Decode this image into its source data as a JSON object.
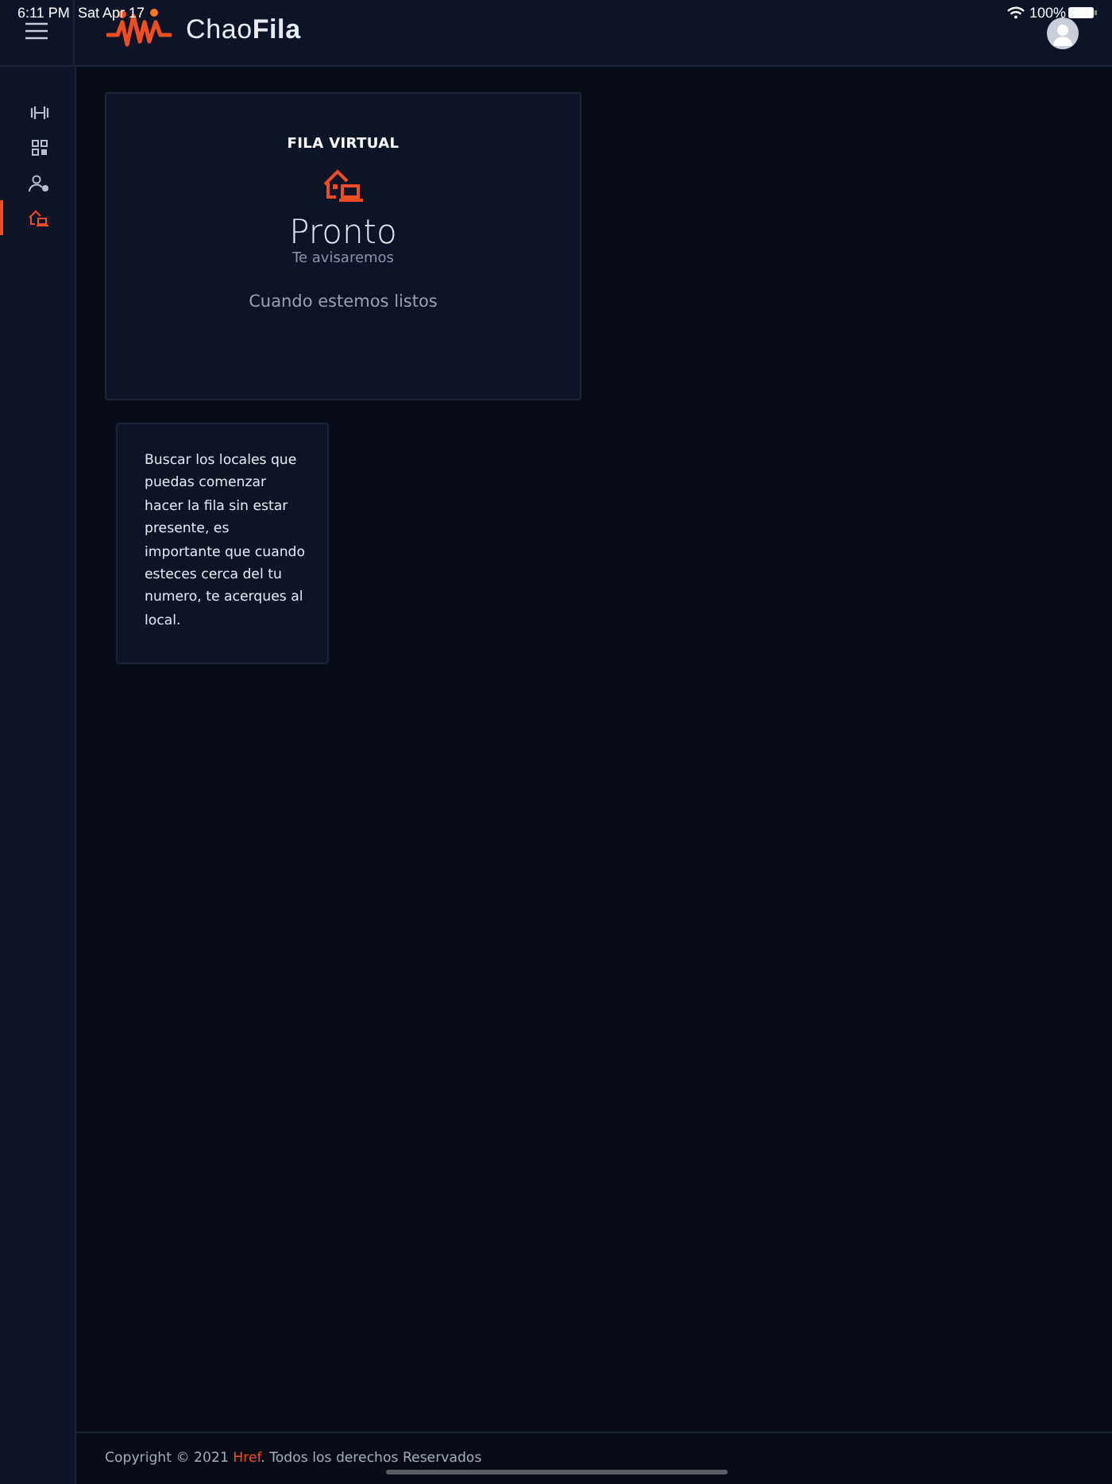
{
  "status_bar": {
    "time": "6:11 PM",
    "date": "Sat Apr 17",
    "battery": "100%"
  },
  "header": {
    "logo_text": "Chao**Fila**"
  },
  "sidebar": {
    "items": [
      {
        "kind": "dumbbell",
        "selected": false
      },
      {
        "kind": "qr",
        "selected": false
      },
      {
        "kind": "user",
        "selected": false
      },
      {
        "kind": "home-laptop",
        "selected": true
      }
    ]
  },
  "status_card": {
    "title": "FILA VIRTUAL",
    "status": "Pronto",
    "subtitle": "Te avisaremos",
    "note": "Cuando estemos listos"
  },
  "info_card": {
    "text": "Buscar los locales que puedas comenzar hacer la fila sin estar presente, es importante que cuando esteces cerca del tu numero, te acerques al local."
  },
  "footer": {
    "before": "Copyright © 2021 ",
    "link": "Href",
    "after": ". Todos los derechos Reservados"
  }
}
